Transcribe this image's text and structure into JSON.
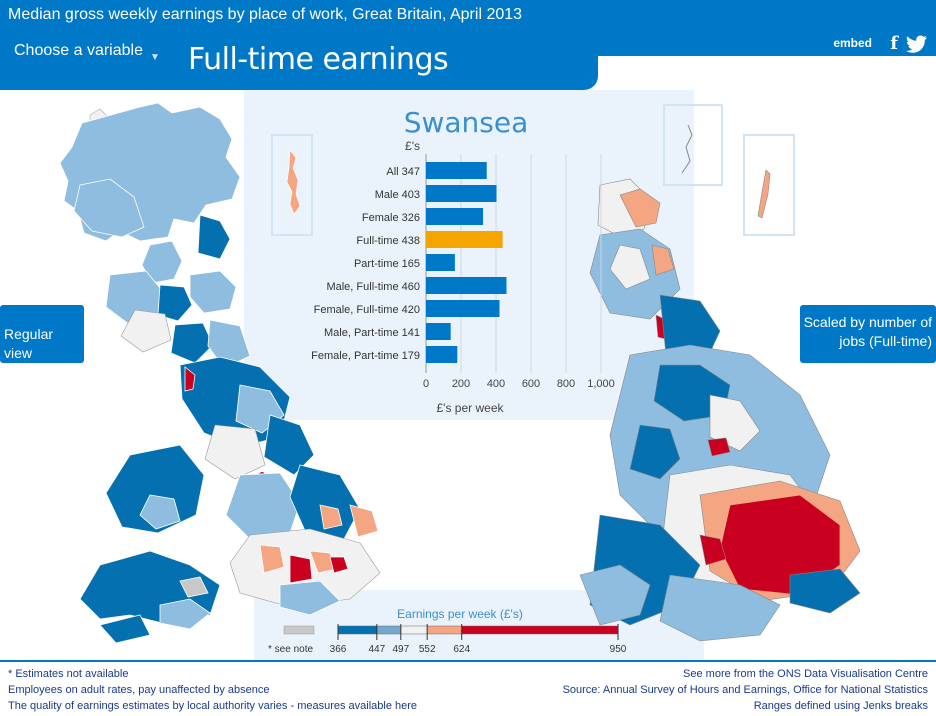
{
  "header": {
    "title": "Median gross weekly earnings by place of work, Great Britain, April 2013",
    "choose_label": "Choose a variable",
    "variable_title": "Full-time earnings",
    "embed": "embed",
    "facebook_icon": "facebook-icon",
    "twitter_icon": "twitter-icon"
  },
  "buttons": {
    "regular_view": "Regular view",
    "scaled_view": "Scaled by number of jobs (Full-time)"
  },
  "chart_data": {
    "type": "bar",
    "title": "Swansea",
    "ylabel": "£'s",
    "xlabel": "£'s per week",
    "categories": [
      "All",
      "Male",
      "Female",
      "Full-time",
      "Part-time",
      "Male, Full-time",
      "Female, Full-time",
      "Male, Part-time",
      "Female, Part-time"
    ],
    "values": [
      347,
      403,
      326,
      438,
      165,
      460,
      420,
      141,
      179
    ],
    "highlight": "Full-time",
    "xlim": [
      0,
      1000
    ],
    "xticks": [
      "0",
      "200",
      "400",
      "600",
      "800",
      "1,000"
    ],
    "bar_color": "#0078c8",
    "highlight_color": "#f5a500",
    "grid": true
  },
  "legend": {
    "title": "Earnings per week (£'s)",
    "na_label": "* see note",
    "breaks": [
      "366",
      "447",
      "497",
      "552",
      "624",
      "950"
    ],
    "colors": [
      "#0570b0",
      "#74a9cf",
      "#f1f1f1",
      "#f4a582",
      "#ca0020"
    ],
    "na_color": "#c8c8c8"
  },
  "footer": {
    "note1": "* Estimates not available",
    "note2": "Employees on adult rates, pay unaffected by absence",
    "note3": "The quality of earnings estimates by local authority varies - measures available here",
    "link1": "See more from the ONS Data Visualisation Centre",
    "source": "Source: Annual Survey of Hours and Earnings, Office for National Statistics",
    "ranges": "Ranges defined using Jenks breaks"
  }
}
